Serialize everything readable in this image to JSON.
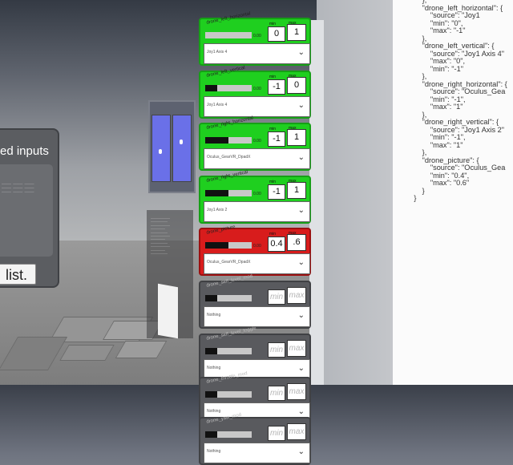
{
  "doc_lines": [
    "            },",
    "            \"drone_left_horizontal\": {",
    "                \"source\": \"Joy1",
    "                \"min\": \"0\",",
    "                \"max\": \"-1\"",
    "            },",
    "            \"drone_left_vertical\": {",
    "                \"source\": \"Joy1 Axis 4\"",
    "                \"max\": \"0\",",
    "                \"min\": \"-1\"",
    "            },",
    "            \"drone_right_horizontal\": {",
    "                \"source\": \"Oculus_Gea",
    "                \"min\": \"-1\",",
    "                \"max\": \"1\"",
    "            },",
    "            \"drone_right_vertical\": {",
    "                \"source\": \"Joy1 Axis 2\"",
    "                \"min\": \"-1\",",
    "                \"max\": \"1\"",
    "            },",
    "            \"drone_picture\": {",
    "                \"source\": \"Oculus_Gea",
    "                \"min\": \"0.4\",",
    "                \"max\": \"0.6\"",
    "            }",
    "        }"
  ],
  "left_panel": {
    "title": "ed inputs",
    "list_button": "list."
  },
  "cards": [
    {
      "title": "drone_left_horizontal",
      "status": "green",
      "bar": 0.0,
      "bar_value": "0.00",
      "min_label": "min",
      "max_label": "max",
      "min": "0",
      "max": "1",
      "source": "Joy1 Axis 4"
    },
    {
      "title": "drone_left_vertical",
      "status": "green",
      "bar": 0.25,
      "bar_value": "0.00",
      "min_label": "min",
      "max_label": "max",
      "min": "-1",
      "max": "0",
      "source": "Joy1 Axis 4"
    },
    {
      "title": "drone_right_horizontal",
      "status": "green",
      "bar": 0.5,
      "bar_value": "0.00",
      "min_label": "min",
      "max_label": "max",
      "min": "-1",
      "max": "1",
      "source": "Oculus_GearVR_DpadX"
    },
    {
      "title": "drone_right_vertical",
      "status": "green",
      "bar": 0.5,
      "bar_value": "0.00",
      "min_label": "min",
      "max_label": "max",
      "min": "-1",
      "max": "1",
      "source": "Joy1 Axis 2"
    },
    {
      "title": "drone_picture",
      "status": "red",
      "bar": 0.5,
      "bar_value": "0.00",
      "min_label": "min",
      "max_label": "max",
      "min": "0.4",
      "max": ".6",
      "source": "Oculus_GearVR_DpadX"
    },
    {
      "title": "drone_self_level_mod",
      "status": "gray",
      "bar": 0.25,
      "bar_value": "",
      "min_label": "",
      "max_label": "",
      "min": "min",
      "max": "max",
      "source": "Nothing"
    },
    {
      "title": "drone_self_level_toggle",
      "status": "gray",
      "bar": 0.25,
      "bar_value": "",
      "min_label": "",
      "max_label": "",
      "min": "min",
      "max": "max",
      "source": "Nothing"
    },
    {
      "title": "drone_throttle_mod",
      "status": "gray",
      "bar": 0.25,
      "bar_value": "",
      "min_label": "",
      "max_label": "",
      "min": "min",
      "max": "max",
      "source": "Nothing"
    },
    {
      "title": "drone_yaw_mod",
      "status": "gray",
      "bar": 0.25,
      "bar_value": "",
      "min_label": "",
      "max_label": "",
      "min": "min",
      "max": "max",
      "source": "Nothing"
    }
  ],
  "icons": {
    "dropdown": "chevron-down-icon"
  },
  "colors": {
    "green": "#1fcf1f",
    "red": "#d81c1c",
    "gray": "#595a5e",
    "screen": "#6a70e8"
  }
}
